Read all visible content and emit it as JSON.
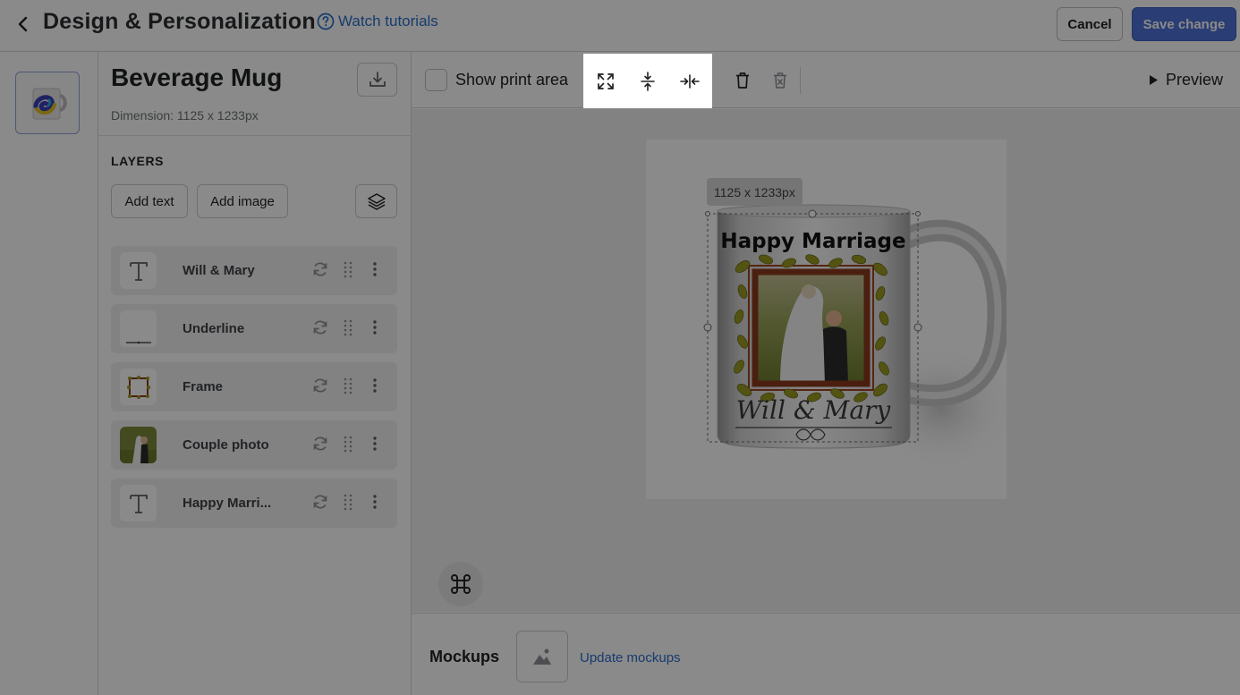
{
  "header": {
    "title": "Design & Personalization",
    "watch_tutorials": "Watch tutorials",
    "cancel": "Cancel",
    "save": "Save change"
  },
  "product": {
    "name": "Beverage Mug",
    "dimension": "Dimension: 1125 x 1233px"
  },
  "layers": {
    "heading": "LAYERS",
    "add_text": "Add text",
    "add_image": "Add image",
    "items": [
      {
        "label": "Will & Mary",
        "kind": "text-icon"
      },
      {
        "label": "Underline",
        "kind": "underline-image"
      },
      {
        "label": "Frame",
        "kind": "frame-image"
      },
      {
        "label": "Couple photo",
        "kind": "photo-image"
      },
      {
        "label": "Happy Marri...",
        "kind": "text-icon"
      }
    ]
  },
  "toolbar": {
    "show_print_area": "Show print area",
    "preview": "Preview"
  },
  "canvas": {
    "size_tag": "1125 x 1233px",
    "mug_title": "Happy Marriage",
    "mug_names": "Will & Mary"
  },
  "mockups": {
    "label": "Mockups",
    "update": "Update mockups"
  },
  "colors": {
    "accent": "#4f71d6",
    "link": "#2c6ecb",
    "frame_wood": "#8b3a1e",
    "leaf": "#9a9a22"
  }
}
